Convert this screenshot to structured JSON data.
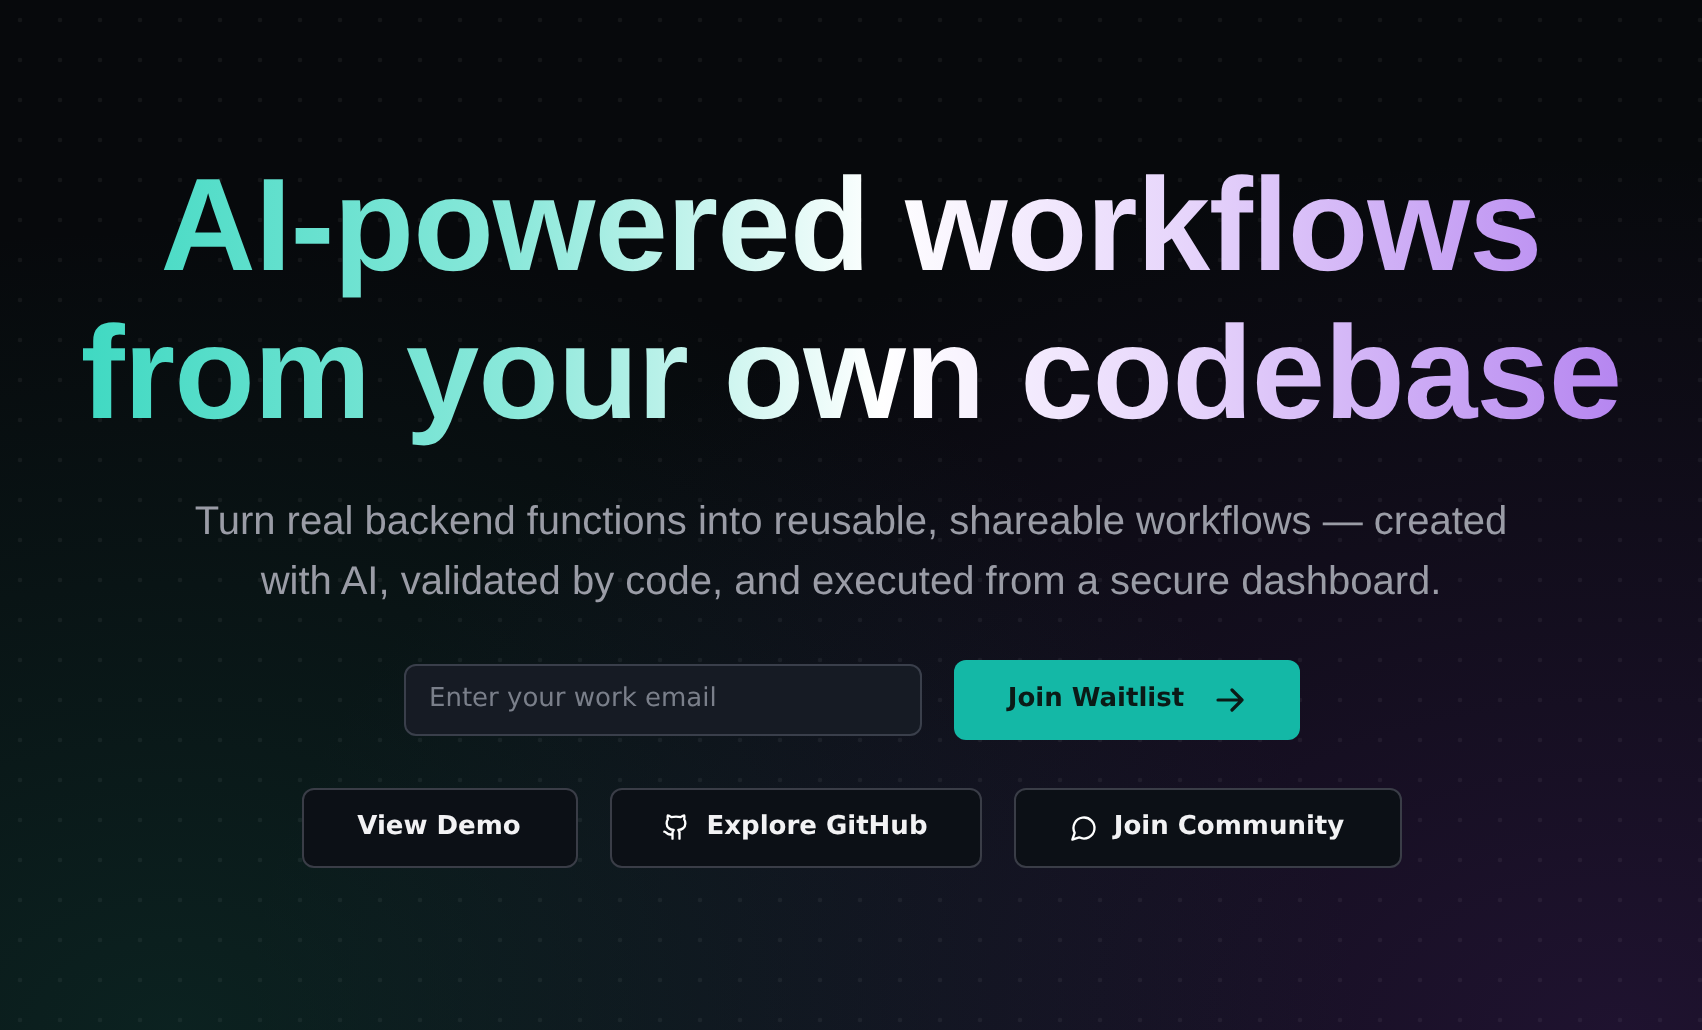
{
  "headline": [
    "AI-powered workflows",
    "from your own codebase"
  ],
  "subtitle": "Turn real backend functions into reusable, shareable workflows — created with AI, validated by code, and executed from a secure dashboard.",
  "signup": {
    "placeholder": "Enter your work email",
    "button": "Join Waitlist"
  },
  "actions": [
    {
      "label": "View Demo",
      "kind": "plain"
    },
    {
      "label": "Explore GitHub",
      "kind": "github"
    },
    {
      "label": "Join Community",
      "kind": "chat"
    }
  ]
}
